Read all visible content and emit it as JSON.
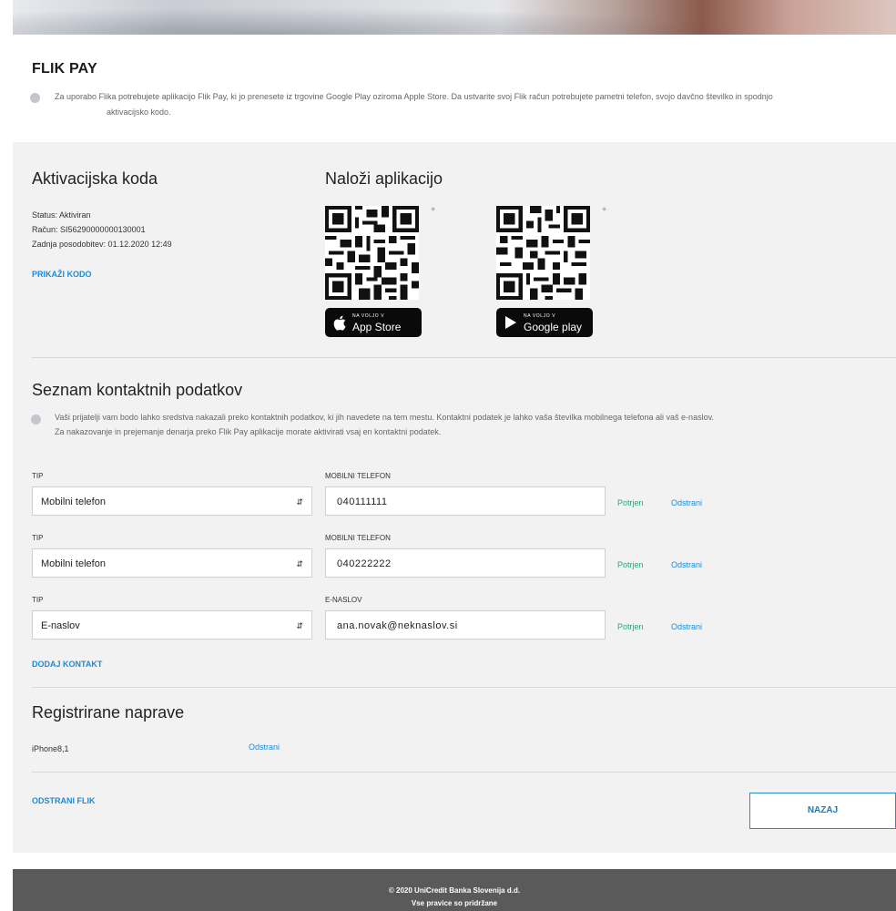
{
  "flik": {
    "title": "FLIK PAY",
    "info_line1": "Za uporabo Flika potrebujete aplikacijo Flik Pay, ki jo prenesete iz trgovine Google Play oziroma Apple Store. Da ustvarite svoj Flik račun potrebujete pametni telefon, svojo davčno številko in spodnjo",
    "info_line2": "aktivacijsko kodo."
  },
  "activation": {
    "title": "Aktivacijska koda",
    "status": "Status: Aktiviran",
    "account": "Račun: SI56290000000130001",
    "last_update": "Zadnja posodobitev: 01.12.2020 12:49",
    "show_code": "PRIKAŽI KODO"
  },
  "download": {
    "title": "Naloži aplikacijo",
    "appstore_small": "NA VOLJO V",
    "appstore_big": "App Store",
    "googleplay_small": "NA VOLJO V",
    "googleplay_big": "Google play"
  },
  "contacts": {
    "title": "Seznam kontaktnih podatkov",
    "info_line1": "Vaši prijatelji vam bodo lahko sredstva nakazali preko kontaktnih podatkov, ki jih navedete na tem mestu. Kontaktni podatek je lahko vaša številka mobilnega telefona ali vaš e-naslov.",
    "info_line2": "Za nakazovanje in prejemanje denarja preko Flik Pay aplikacije morate aktivirati vsaj en kontaktni podatek.",
    "rows": [
      {
        "type_label": "TIP",
        "type_value": "Mobilni telefon",
        "value_label": "MOBILNI TELEFON",
        "value": "040111111",
        "status": "Potrjen",
        "remove": "Odstrani"
      },
      {
        "type_label": "TIP",
        "type_value": "Mobilni telefon",
        "value_label": "MOBILNI TELEFON",
        "value": "040222222",
        "status": "Potrjen",
        "remove": "Odstrani"
      },
      {
        "type_label": "TIP",
        "type_value": "E-naslov",
        "value_label": "E-NASLOV",
        "value": "ana.novak@neknaslov.si",
        "status": "Potrjen",
        "remove": "Odstrani"
      }
    ],
    "add_contact": "DODAJ KONTAKT"
  },
  "devices": {
    "title": "Registrirane naprave",
    "device_name": "iPhone8,1",
    "remove": "Odstrani"
  },
  "actions": {
    "remove_flik": "ODSTRANI FLIK",
    "back": "NAZAJ"
  },
  "footer": {
    "copyright": "© 2020 UniCredit Banka Slovenija d.d.",
    "rights": "Vse pravice so pridržane"
  },
  "icons": {
    "info": "info-icon",
    "apple": "apple-icon",
    "android": "android-icon",
    "select_arrow": "updown-arrow-icon",
    "play": "play-store-icon"
  },
  "colors": {
    "link": "#1d8bd6",
    "confirmed": "#2aa57e",
    "footer_bg": "#5a5a5a",
    "panel_bg": "#f2f2f2"
  }
}
